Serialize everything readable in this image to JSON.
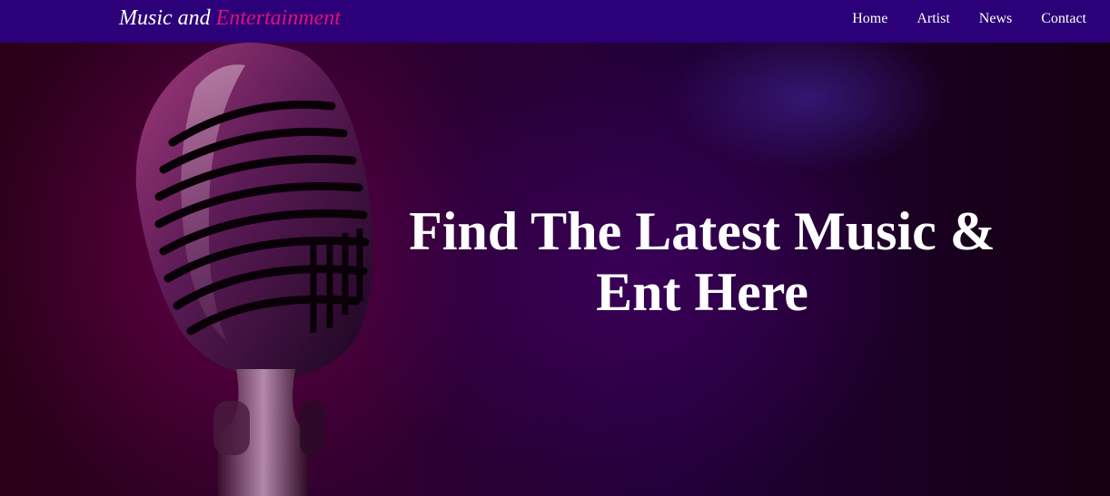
{
  "navbar": {
    "brand": {
      "prefix": "Music and",
      "accent": "Entertainment"
    },
    "links": [
      {
        "label": "Home"
      },
      {
        "label": "Artist"
      },
      {
        "label": "News"
      },
      {
        "label": "Contact"
      }
    ]
  },
  "hero": {
    "title_line1": "Find The Latest Music &",
    "title_line2": "Ent Here",
    "background_image": "microphone"
  },
  "colors": {
    "navbar_bg": "#2c0078",
    "brand_accent": "#e0107a",
    "text": "#ffffff"
  }
}
